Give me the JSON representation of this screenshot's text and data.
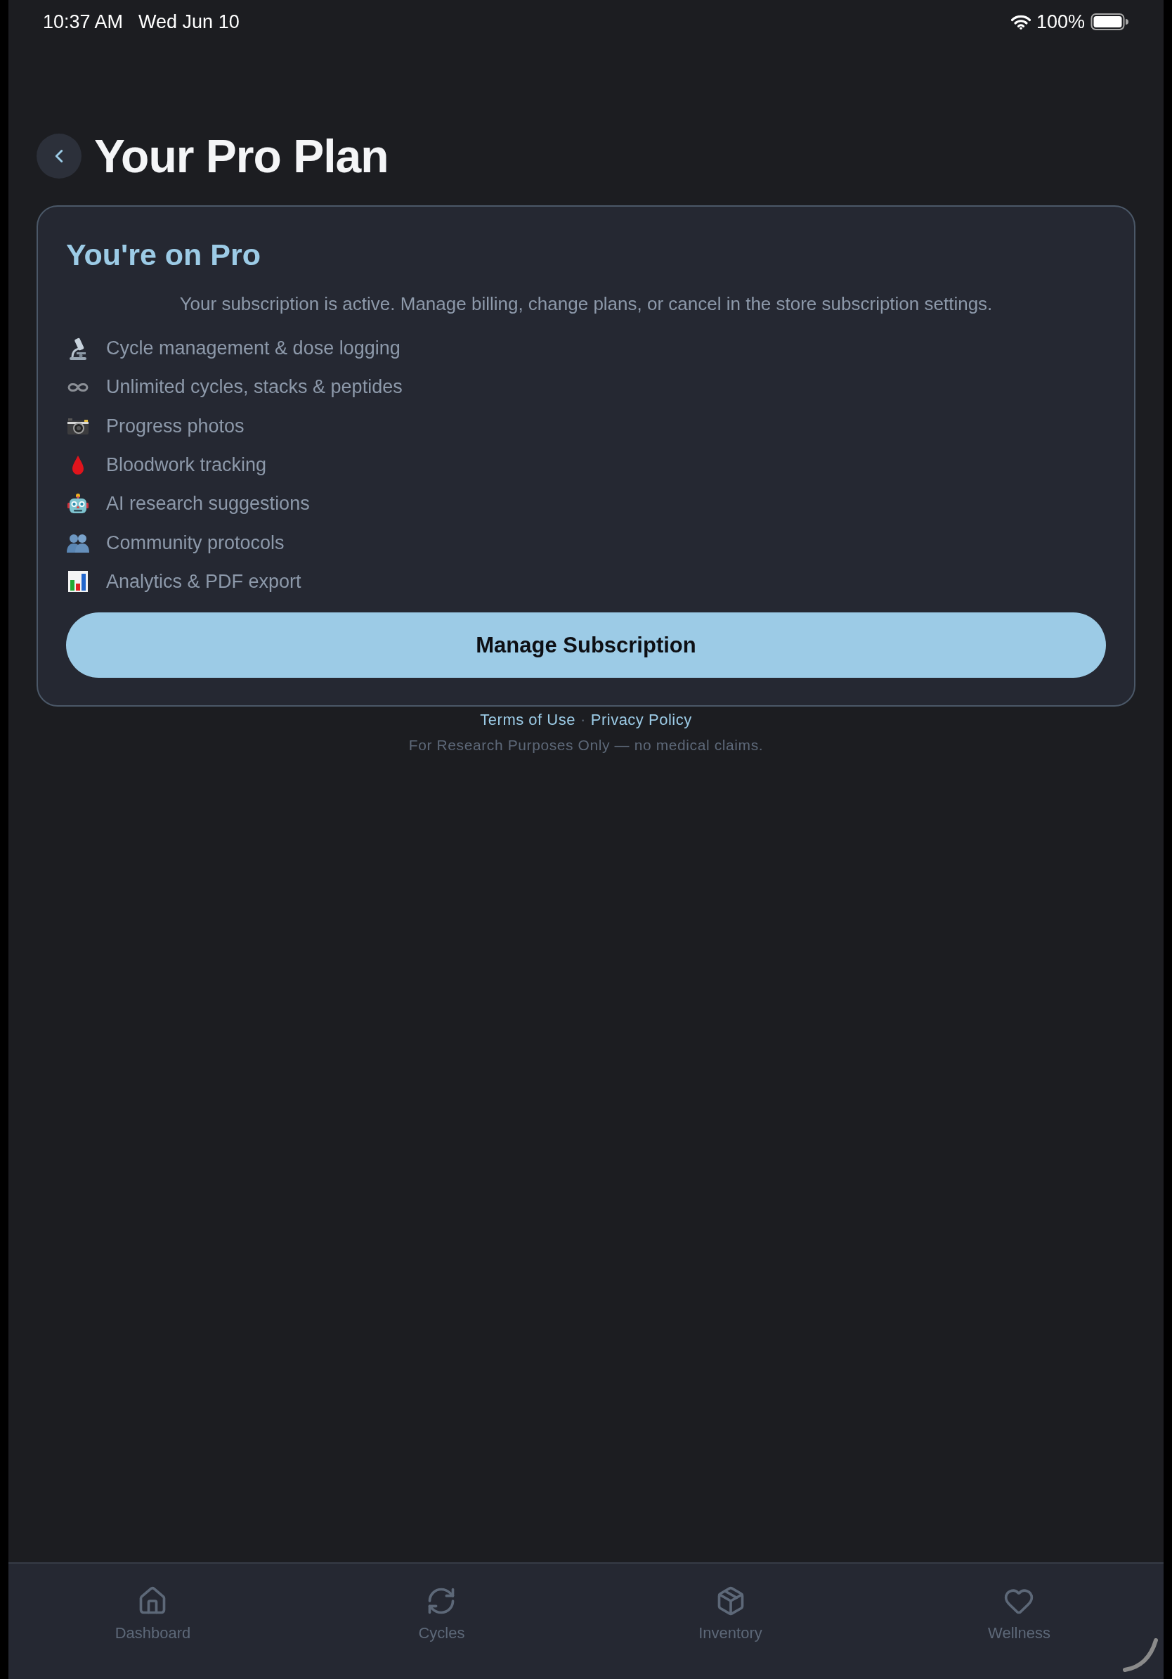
{
  "status_bar": {
    "time": "10:37 AM",
    "date": "Wed Jun 10",
    "battery": "100%"
  },
  "header": {
    "title": "Your Pro Plan"
  },
  "plan_card": {
    "title": "You're on Pro",
    "description": "Your subscription is active. Manage billing, change plans, or cancel in the store subscription settings.",
    "features": [
      "Cycle management & dose logging",
      "Unlimited cycles, stacks & peptides",
      "Progress photos",
      "Bloodwork tracking",
      "AI research suggestions",
      "Community protocols",
      "Analytics & PDF export"
    ],
    "button": "Manage Subscription"
  },
  "footer": {
    "links": [
      "Terms of Use",
      "Privacy Policy"
    ],
    "separator": "·",
    "disclaimer": "For Research Purposes Only — no medical claims."
  },
  "tab_bar": [
    {
      "label": "Dashboard",
      "selected": false
    },
    {
      "label": "Cycles",
      "selected": false
    },
    {
      "label": "Inventory",
      "selected": false
    },
    {
      "label": "Wellness",
      "selected": false
    }
  ]
}
